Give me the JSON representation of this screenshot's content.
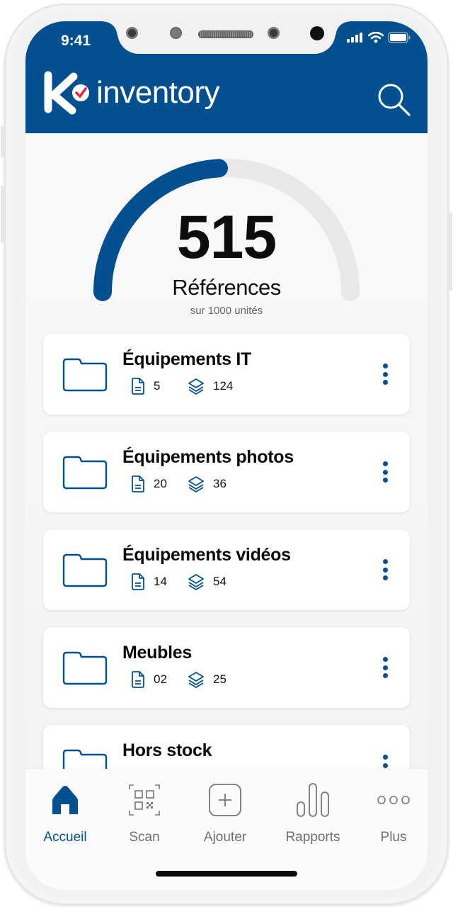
{
  "status_bar": {
    "time": "9:41"
  },
  "header": {
    "logo_letter": "K",
    "app_name": "inventory",
    "search_icon": "search-icon"
  },
  "gauge": {
    "value": "515",
    "label": "Références",
    "sublabel": "sur 1000 unités",
    "progress_fraction": 0.48,
    "colors": {
      "fill": "#02508f",
      "track": "#e8e8e8"
    }
  },
  "categories": [
    {
      "title": "Équipements IT",
      "files": "5",
      "items": "124"
    },
    {
      "title": "Équipements photos",
      "files": "20",
      "items": "36"
    },
    {
      "title": "Équipements vidéos",
      "files": "14",
      "items": "54"
    },
    {
      "title": "Meubles",
      "files": "02",
      "items": "25"
    },
    {
      "title": "Hors stock",
      "files": "",
      "items": ""
    }
  ],
  "tabbar": {
    "tabs": [
      {
        "label": "Accueil",
        "icon": "home-icon",
        "active": true
      },
      {
        "label": "Scan",
        "icon": "qr-scan-icon",
        "active": false
      },
      {
        "label": "Ajouter",
        "icon": "add-icon",
        "active": false
      },
      {
        "label": "Rapports",
        "icon": "bar-chart-icon",
        "active": false
      },
      {
        "label": "Plus",
        "icon": "more-horizontal-icon",
        "active": false
      }
    ]
  },
  "theme": {
    "primary": "#02508f",
    "accent_check": "#e0243c",
    "inactive": "#6f6f6f"
  }
}
